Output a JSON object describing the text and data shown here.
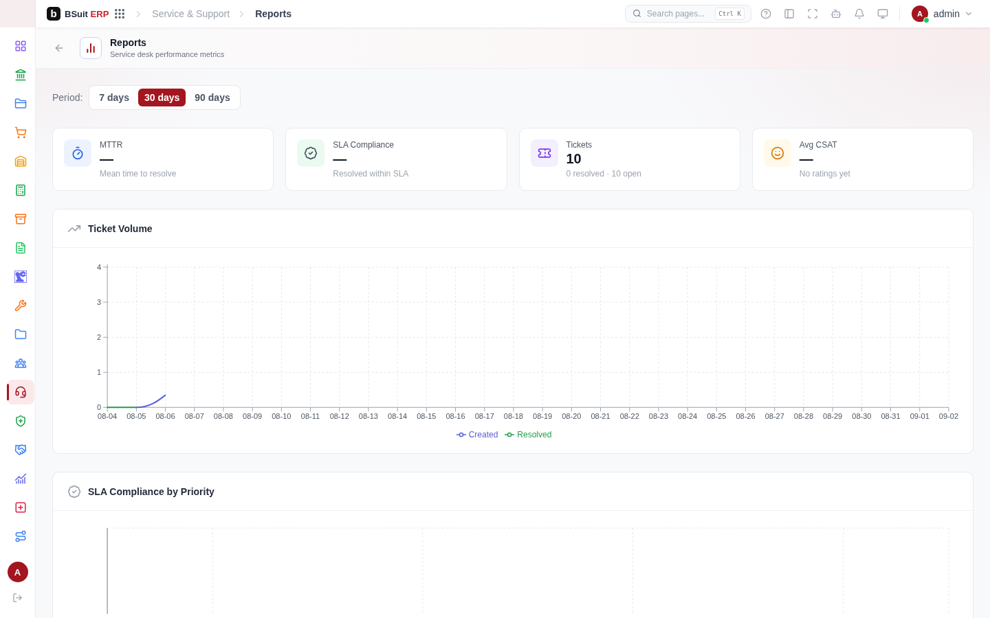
{
  "top_bar": {
    "brand": {
      "mark": "b",
      "name": "BSuit",
      "suffix": "ERP"
    },
    "breadcrumbs": [
      {
        "label": "Service & Support",
        "current": false
      },
      {
        "label": "Reports",
        "current": true
      }
    ],
    "search": {
      "placeholder": "Search pages...",
      "shortcut": "Ctrl K"
    },
    "user": {
      "initial": "A",
      "name": "admin",
      "online": true
    }
  },
  "sidebar": {
    "items": [
      {
        "selected": false
      },
      {
        "selected": false
      },
      {
        "selected": false
      },
      {
        "selected": false
      },
      {
        "selected": false
      },
      {
        "selected": false
      },
      {
        "selected": false
      },
      {
        "selected": false
      },
      {
        "selected": false
      },
      {
        "selected": false
      },
      {
        "selected": false
      },
      {
        "selected": false
      },
      {
        "selected": true
      },
      {
        "selected": false
      },
      {
        "selected": false
      },
      {
        "selected": false
      },
      {
        "selected": false
      },
      {
        "selected": false
      }
    ],
    "user_initial": "A"
  },
  "page_header": {
    "title": "Reports",
    "subtitle": "Service desk performance metrics"
  },
  "period": {
    "label": "Period:",
    "options": [
      {
        "label": "7 days",
        "selected": false
      },
      {
        "label": "30 days",
        "selected": true
      },
      {
        "label": "90 days",
        "selected": false
      }
    ]
  },
  "stats": [
    {
      "kind": "time",
      "label": "MTTR",
      "value": "—",
      "note": "Mean time to resolve"
    },
    {
      "kind": "sla",
      "label": "SLA Compliance",
      "value": "—",
      "note": "Resolved within SLA"
    },
    {
      "kind": "count",
      "label": "Tickets",
      "value": "10",
      "note": "0 resolved · 10 open"
    },
    {
      "kind": "rating",
      "label": "Avg CSAT",
      "value": "—",
      "note": "No ratings yet"
    }
  ],
  "ticket_volume": {
    "title": "Ticket Volume",
    "chart_data": {
      "type": "line",
      "grid": true,
      "legend": "bottom",
      "categories": [
        "08-04",
        "08-05",
        "08-06",
        "08-07",
        "08-08",
        "08-09",
        "08-10",
        "08-11",
        "08-12",
        "08-13",
        "08-14",
        "08-15",
        "08-16",
        "08-17",
        "08-18",
        "08-19",
        "08-20",
        "08-21",
        "08-22",
        "08-23",
        "08-24",
        "08-25",
        "08-26",
        "08-27",
        "08-28",
        "08-29",
        "08-30",
        "08-31",
        "09-01",
        "09-02"
      ],
      "ylim": [
        0,
        4
      ],
      "yticks": [
        0,
        1,
        2,
        3,
        4
      ],
      "series": [
        {
          "name": "Created",
          "color": "#5b5fd6",
          "values": [
            null,
            0,
            0.35,
            null,
            null,
            null,
            null,
            null,
            null,
            null,
            null,
            null,
            null,
            null,
            null,
            null,
            null,
            null,
            null,
            null,
            null,
            null,
            null,
            null,
            null,
            null,
            null,
            null,
            null,
            null
          ]
        },
        {
          "name": "Resolved",
          "color": "#22a04b",
          "values": [
            0,
            0,
            null,
            null,
            null,
            null,
            null,
            null,
            null,
            null,
            null,
            null,
            null,
            null,
            null,
            null,
            null,
            null,
            null,
            null,
            null,
            null,
            null,
            null,
            null,
            null,
            null,
            null,
            null,
            null
          ]
        }
      ]
    }
  },
  "sla_by_priority": {
    "title": "SLA Compliance by Priority"
  }
}
